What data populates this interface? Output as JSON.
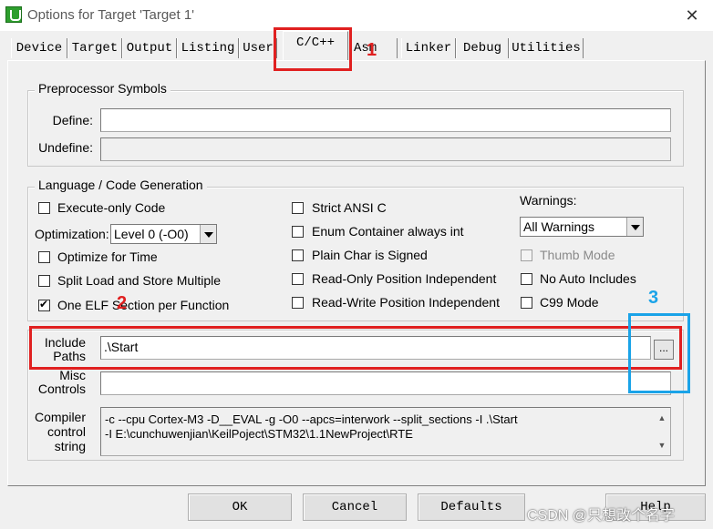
{
  "window": {
    "title": "Options for Target 'Target 1'",
    "close_glyph": "✕"
  },
  "tabs": [
    {
      "label": "Device"
    },
    {
      "label": "Target"
    },
    {
      "label": "Output"
    },
    {
      "label": "Listing"
    },
    {
      "label": "User"
    },
    {
      "label": "C/C++"
    },
    {
      "label": "Asm"
    },
    {
      "label": "Linker"
    },
    {
      "label": "Debug"
    },
    {
      "label": "Utilities"
    }
  ],
  "active_tab": "C/C++",
  "preprocessor": {
    "legend": "Preprocessor Symbols",
    "define_label": "Define:",
    "define_value": "",
    "undefine_label": "Undefine:",
    "undefine_value": ""
  },
  "language": {
    "legend": "Language / Code Generation",
    "execute_only": {
      "label": "Execute-only Code",
      "checked": false
    },
    "optimization_label": "Optimization:",
    "optimization_value": "Level 0 (-O0)",
    "optimize_time": {
      "label": "Optimize for Time",
      "checked": false
    },
    "split_load": {
      "label": "Split Load and Store Multiple",
      "checked": false
    },
    "one_elf": {
      "label": "One ELF Section per Function",
      "checked": true
    },
    "strict_ansi": {
      "label": "Strict ANSI C",
      "checked": false
    },
    "enum_container": {
      "label": "Enum Container always int",
      "checked": false
    },
    "plain_char": {
      "label": "Plain Char is Signed",
      "checked": false
    },
    "ro_pos": {
      "label": "Read-Only Position Independent",
      "checked": false
    },
    "rw_pos": {
      "label": "Read-Write Position Independent",
      "checked": false
    },
    "warnings_label": "Warnings:",
    "warnings_value": "All Warnings",
    "thumb_mode": {
      "label": "Thumb Mode",
      "checked": false,
      "disabled": true
    },
    "no_auto_includes": {
      "label": "No Auto Includes",
      "checked": false
    },
    "c99_mode": {
      "label": "C99 Mode",
      "checked": false
    }
  },
  "include_paths": {
    "label_line1": "Include",
    "label_line2": "Paths",
    "value": ".\\Start",
    "browse_label": "..."
  },
  "misc_controls": {
    "label_line1": "Misc",
    "label_line2": "Controls",
    "value": ""
  },
  "compiler_control": {
    "label_line1": "Compiler",
    "label_line2": "control",
    "label_line3": "string",
    "line1": "-c --cpu Cortex-M3 -D__EVAL -g -O0 --apcs=interwork --split_sections -I .\\Start",
    "line2": "-I E:\\cunchuwenjian\\KeilPoject\\STM32\\1.1NewProject\\RTE"
  },
  "buttons": {
    "ok": "OK",
    "cancel": "Cancel",
    "defaults": "Defaults",
    "help": "Help"
  },
  "annotations": {
    "num1": "1",
    "num2": "2",
    "num3": "3",
    "red_color": "#e02020",
    "blue_color": "#1aa3e8"
  },
  "watermark": "CSDN @只想改个名字"
}
